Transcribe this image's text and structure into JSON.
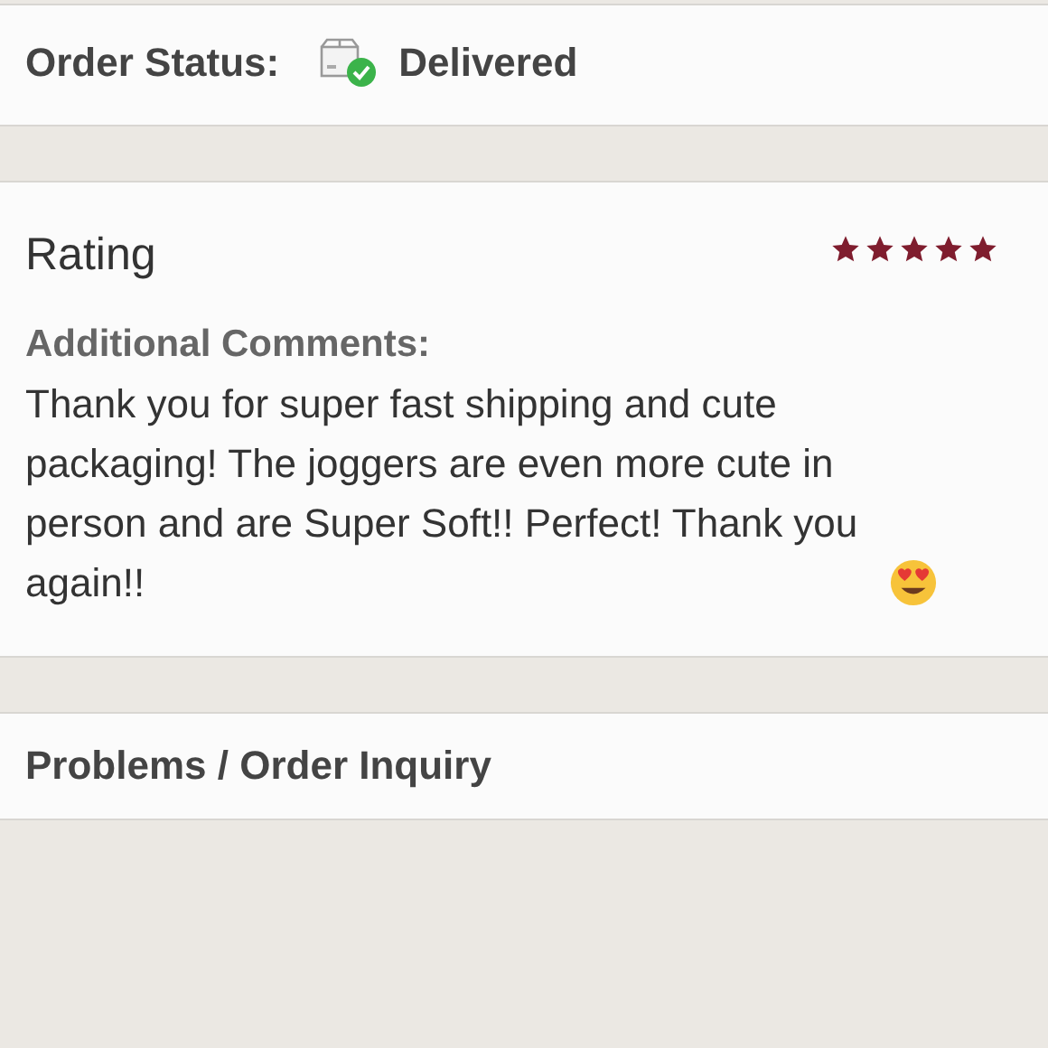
{
  "order_status": {
    "label": "Order Status:",
    "value": "Delivered"
  },
  "rating": {
    "title": "Rating",
    "stars": 5,
    "comments_label": "Additional Comments:",
    "comments": "Thank you for super fast shipping and cute packaging! The joggers are even more cute in person and are Super Soft!! Perfect! Thank you again!!"
  },
  "problems": {
    "label": "Problems / Order Inquiry"
  }
}
